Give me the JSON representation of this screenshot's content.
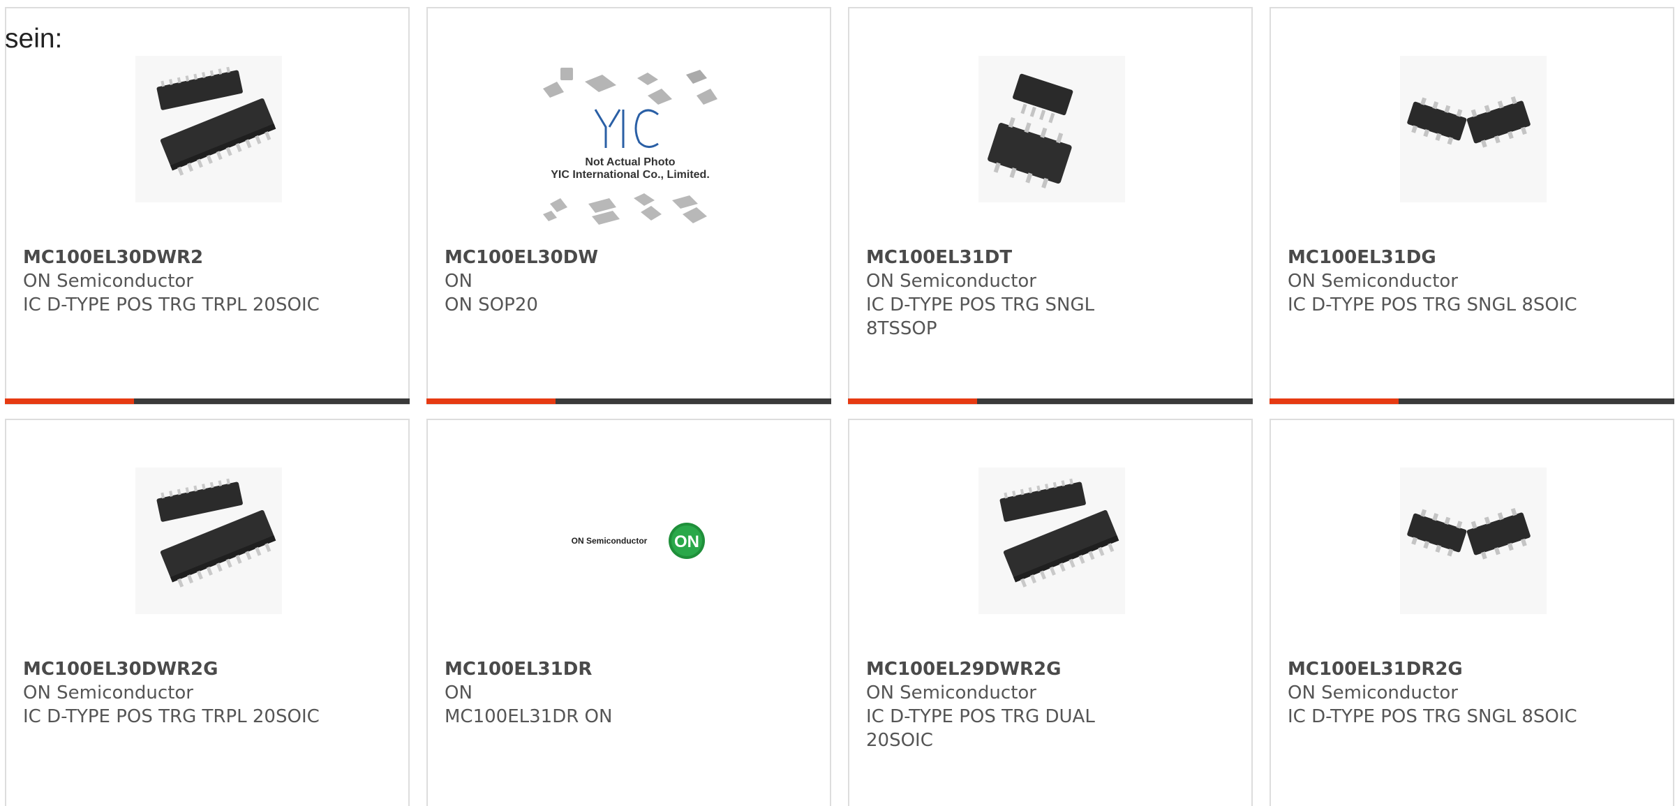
{
  "lead_text": "sein:",
  "colors": {
    "accent": "#e63a12",
    "bar": "#3a3a3a",
    "border": "#dddddd",
    "text": "#555555"
  },
  "products": [
    {
      "part_number": "MC100EL30DWR2",
      "manufacturer": "ON Semiconductor",
      "description": "IC D-TYPE POS TRG TRPL 20SOIC",
      "image": "soic-20-chip-photo"
    },
    {
      "part_number": "MC100EL30DW",
      "manufacturer": "ON",
      "description": "ON SOP20",
      "image": "yic-placeholder-photo",
      "image_text": {
        "logo": "YIC",
        "line1": "Not Actual Photo",
        "line2": "YIC International Co., Limited."
      }
    },
    {
      "part_number": "MC100EL31DT",
      "manufacturer": "ON Semiconductor",
      "description": "IC D-TYPE POS TRG SNGL 8TSSOP",
      "image": "tssop-8-chip-photo"
    },
    {
      "part_number": "MC100EL31DG",
      "manufacturer": "ON Semiconductor",
      "description": "IC D-TYPE POS TRG SNGL 8SOIC",
      "image": "soic-8-chip-photo"
    },
    {
      "part_number": "MC100EL30DWR2G",
      "manufacturer": "ON Semiconductor",
      "description": "IC D-TYPE POS TRG TRPL 20SOIC",
      "image": "soic-20-chip-photo"
    },
    {
      "part_number": "MC100EL31DR",
      "manufacturer": "ON",
      "description": "MC100EL31DR ON",
      "image": "on-semiconductor-logo",
      "image_text": {
        "brand": "ON Semiconductor",
        "badge": "ON"
      }
    },
    {
      "part_number": "MC100EL29DWR2G",
      "manufacturer": "ON Semiconductor",
      "description": "IC D-TYPE POS TRG DUAL 20SOIC",
      "image": "soic-20-chip-photo"
    },
    {
      "part_number": "MC100EL31DR2G",
      "manufacturer": "ON Semiconductor",
      "description": "IC D-TYPE POS TRG SNGL 8SOIC",
      "image": "soic-8-chip-photo"
    }
  ]
}
